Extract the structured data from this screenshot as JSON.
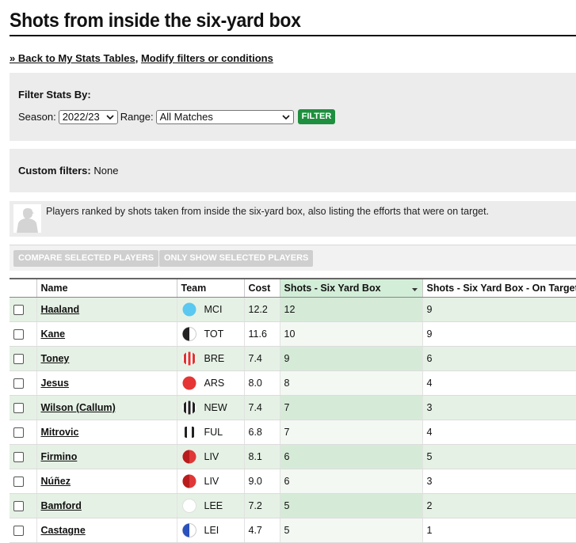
{
  "page": {
    "title": "Shots from inside the six-yard box",
    "back_link": "» Back to My Stats Tables",
    "separator": ",",
    "modify_link": "Modify filters or conditions"
  },
  "filters": {
    "heading": "Filter Stats By:",
    "season_label": "Season:",
    "season_value": "2022/23",
    "range_label": "Range:",
    "range_value": "All Matches",
    "filter_button": "FILTER"
  },
  "custom_filters": {
    "label": "Custom filters:",
    "value": "None"
  },
  "description": "Players ranked by shots taken from inside the six-yard box, also listing the efforts that were on target.",
  "actions": {
    "compare_button": "COMPARE SELECTED PLAYERS",
    "only_show_button": "ONLY SHOW SELECTED PLAYERS"
  },
  "table": {
    "columns": [
      "",
      "Name",
      "Team",
      "Cost",
      "Shots - Six Yard Box",
      "Shots - Six Yard Box - On Target"
    ],
    "sorted_column": "Shots - Six Yard Box",
    "rows": [
      {
        "name": "Haaland",
        "team": "MCI",
        "cost": "12.2",
        "shots": "12",
        "on_target": "9",
        "badge": "sky-blue-solid"
      },
      {
        "name": "Kane",
        "team": "TOT",
        "cost": "11.6",
        "shots": "10",
        "on_target": "9",
        "badge": "white-black-half"
      },
      {
        "name": "Toney",
        "team": "BRE",
        "cost": "7.4",
        "shots": "9",
        "on_target": "6",
        "badge": "red-white-stripes"
      },
      {
        "name": "Jesus",
        "team": "ARS",
        "cost": "8.0",
        "shots": "8",
        "on_target": "4",
        "badge": "red-solid"
      },
      {
        "name": "Wilson (Callum)",
        "team": "NEW",
        "cost": "7.4",
        "shots": "7",
        "on_target": "3",
        "badge": "black-white-stripes"
      },
      {
        "name": "Mitrovic",
        "team": "FUL",
        "cost": "6.8",
        "shots": "7",
        "on_target": "4",
        "badge": "white-black-sides"
      },
      {
        "name": "Firmino",
        "team": "LIV",
        "cost": "8.1",
        "shots": "6",
        "on_target": "5",
        "badge": "red-dark-half"
      },
      {
        "name": "Núñez",
        "team": "LIV",
        "cost": "9.0",
        "shots": "6",
        "on_target": "3",
        "badge": "red-dark-half"
      },
      {
        "name": "Bamford",
        "team": "LEE",
        "cost": "7.2",
        "shots": "5",
        "on_target": "2",
        "badge": "white-solid"
      },
      {
        "name": "Castagne",
        "team": "LEI",
        "cost": "4.7",
        "shots": "5",
        "on_target": "1",
        "badge": "blue-white-half"
      }
    ]
  },
  "colors": {
    "filter_button": "#1e8f3e",
    "alt_row": "#e5f1e5",
    "sorted_header": "#d3eed8",
    "panel_bg": "#ececec",
    "disabled_button": "#cfcfcf"
  }
}
